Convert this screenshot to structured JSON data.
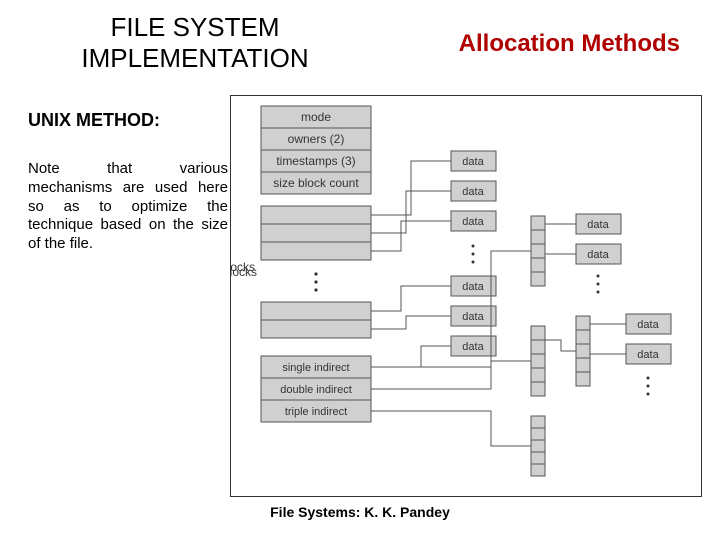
{
  "header": {
    "title": "FILE SYSTEM IMPLEMENTATION",
    "subtitle": "Allocation Methods"
  },
  "section": {
    "heading": "UNIX METHOD:",
    "body": "Note that various mechanisms are used here so as to optimize the technique based on the size of the file."
  },
  "diagram": {
    "inode": [
      "mode",
      "owners (2)",
      "timestamps (3)",
      "size block count",
      "direct blocks",
      "single indirect",
      "double indirect",
      "triple indirect"
    ],
    "direct_label": "direct blocks",
    "data_label": "data"
  },
  "footer": {
    "text": "File Systems: K. K. Pandey"
  }
}
